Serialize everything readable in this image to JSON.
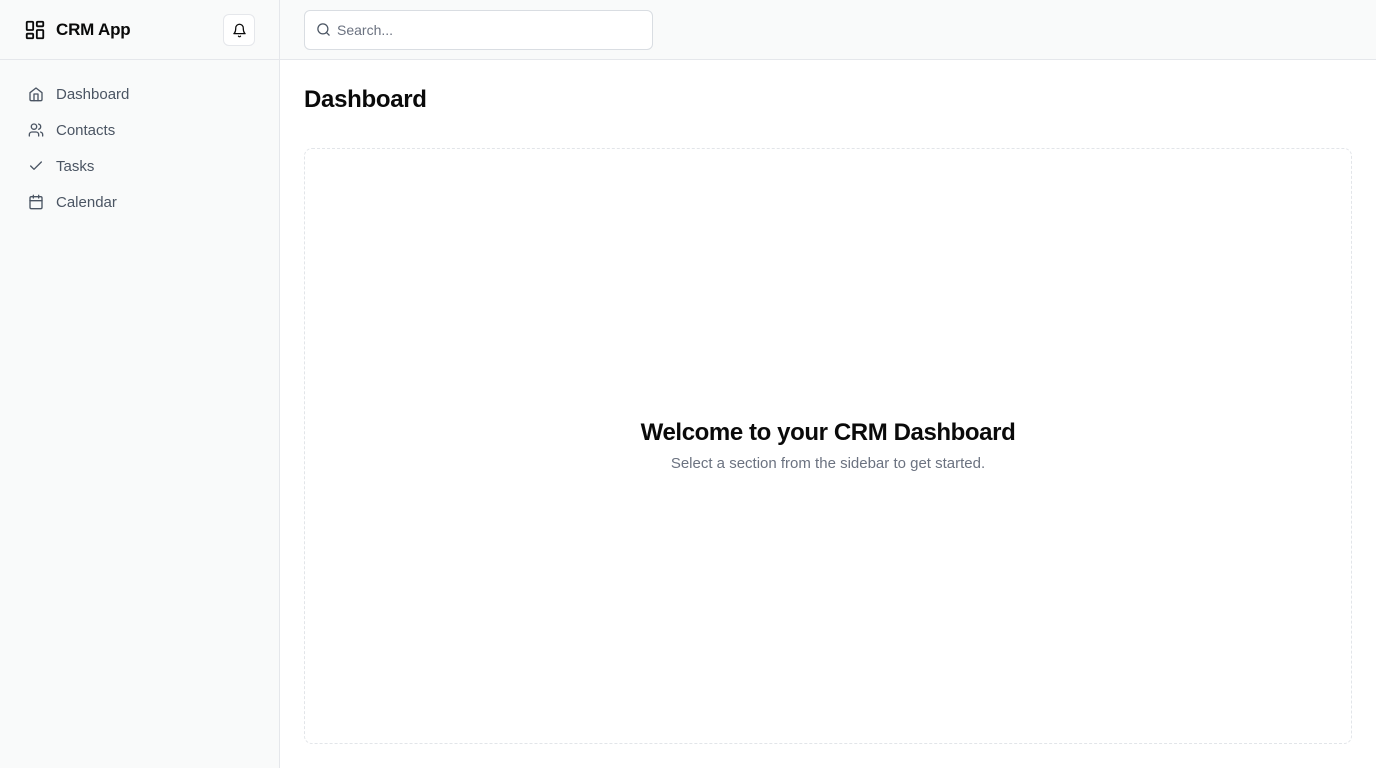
{
  "app": {
    "name": "CRM App"
  },
  "sidebar": {
    "items": [
      {
        "label": "Dashboard",
        "icon": "home-icon"
      },
      {
        "label": "Contacts",
        "icon": "users-icon"
      },
      {
        "label": "Tasks",
        "icon": "check-icon"
      },
      {
        "label": "Calendar",
        "icon": "calendar-icon"
      }
    ]
  },
  "header": {
    "notifications_icon": "bell-icon",
    "search": {
      "placeholder": "Search...",
      "value": ""
    }
  },
  "main": {
    "title": "Dashboard",
    "welcome": {
      "title": "Welcome to your CRM Dashboard",
      "subtitle": "Select a section from the sidebar to get started."
    }
  },
  "colors": {
    "sidebar_bg": "#f9fafa",
    "border": "#e5e7eb",
    "text_primary": "#0a0a0a",
    "text_muted": "#6b7280",
    "nav_text": "#4b5563"
  }
}
